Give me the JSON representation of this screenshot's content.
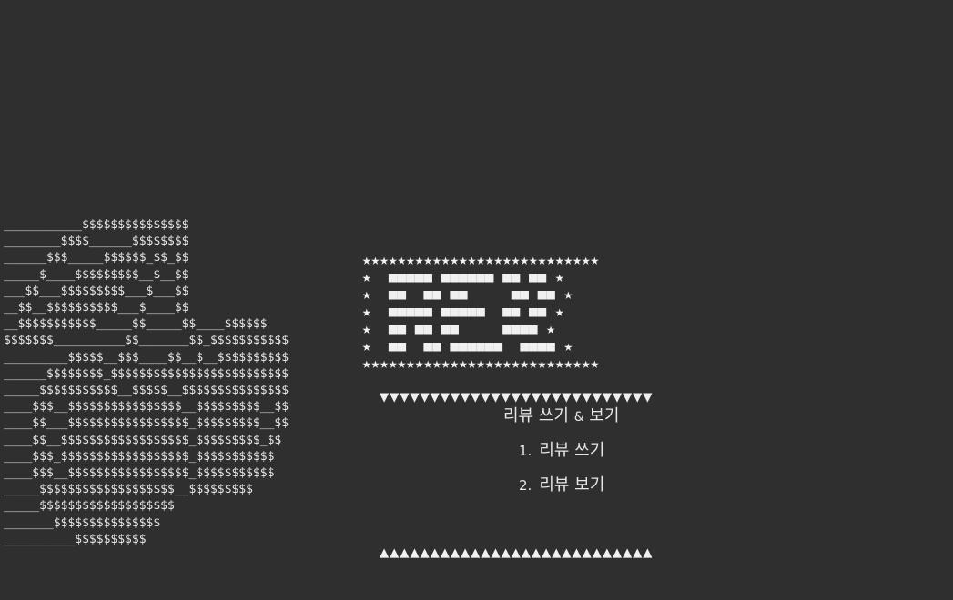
{
  "ascii_art": {
    "lines": [
      "___________$$$$$$$$$$$$$$$",
      "________$$$$______$$$$$$$$",
      "______$$$_____$$$$$$_$$_$$",
      "_____$____$$$$$$$$$__$__$$",
      "___$$___$$$$$$$$$___$___$$",
      "__$$__$$$$$$$$$$___$____$$",
      "__$$$$$$$$$$$_____$$_____$$____$$$$$$",
      "$$$$$$$__________$$_______$$_$$$$$$$$$$$",
      "_________$$$$$__$$$____$$__$__$$$$$$$$$$",
      "______$$$$$$$$_$$$$$$$$$$$$$$$$$$$$$$$$$",
      "_____$$$$$$$$$$$__$$$$$__$$$$$$$$$$$$$$$",
      "____$$$__$$$$$$$$$$$$$$$$__$$$$$$$$$__$$",
      "____$$___$$$$$$$$$$$$$$$$$_$$$$$$$$$__$$",
      "____$$__$$$$$$$$$$$$$$$$$$_$$$$$$$$$_$$",
      "____$$$_$$$$$$$$$$$$$$$$$$_$$$$$$$$$$$",
      "____$$$__$$$$$$$$$$$$$$$$$_$$$$$$$$$$$",
      "_____$$$$$$$$$$$$$$$$$$$__$$$$$$$$$",
      "_____$$$$$$$$$$$$$$$$$$$",
      "_______$$$$$$$$$$$$$$$",
      "__________$$$$$$$$$$"
    ]
  },
  "banner": {
    "lines": [
      "★★★★★★★★★★★★★★★★★★★★★★★★★★★",
      "★  ■■■■■ ■■■■■■ ■■ ■■ ★",
      "★  ■■  ■■ ■■     ■■ ■■ ★",
      "★  ■■■■■ ■■■■■  ■■ ■■ ★",
      "★  ■■ ■■ ■■     ■■■■ ★",
      "★  ■■  ■■ ■■■■■■  ■■■■ ★",
      "★★★★★★★★★★★★★★★★★★★★★★★★★★★"
    ]
  },
  "triangles": {
    "top": "▼▼▼▼▼▼▼▼▼▼▼▼▼▼▼▼▼▼▼▼▼▼▼▼▼▼▼",
    "bottom": "▲▲▲▲▲▲▲▲▲▲▲▲▲▲▲▲▲▲▲▲▲▲▲▲▲▲▲"
  },
  "menu": {
    "title_part1": "리뷰 쓰기 ",
    "title_amp": "&",
    "title_part2": " 보기",
    "items": [
      {
        "number": "1.",
        "label": "리뷰 쓰기"
      },
      {
        "number": "2.",
        "label": "리뷰 보기"
      }
    ]
  }
}
